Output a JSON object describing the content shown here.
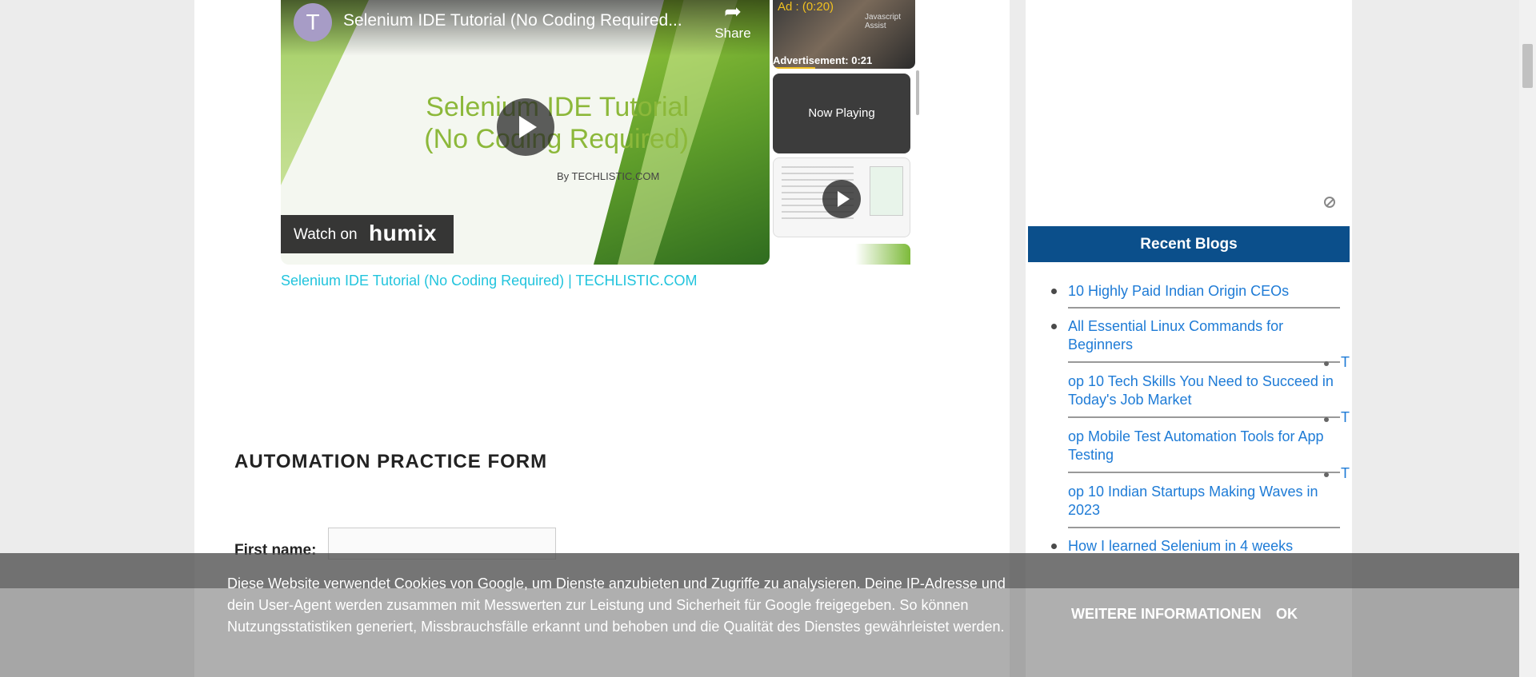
{
  "video": {
    "avatar_letter": "T",
    "title": "Selenium IDE Tutorial (No Coding Required...",
    "share_label": "Share",
    "share_icon": "share-arrow-icon",
    "slide_title_line1": "Selenium IDE Tutorial",
    "slide_title_line2": "(No Coding Required)",
    "slide_byline": "By TECHLISTIC.COM",
    "watch_on_label": "Watch on",
    "watch_on_brand": "humix"
  },
  "playlist": {
    "ad_label": "Ad : (0:20)",
    "ad_tag": "Javascript Assist",
    "ad_time": "Advertisement: 0:21",
    "ad_progress_fraction": 0.3,
    "now_playing": "Now Playing"
  },
  "video_link": "Selenium IDE Tutorial (No Coding Required) | TECHLISTIC.COM",
  "form": {
    "title": "AUTOMATION PRACTICE FORM",
    "first_name_label": "First name:",
    "first_name_value": ""
  },
  "sidebar": {
    "header": "Recent Blogs",
    "header_color": "#0b4f8b",
    "link_color": "#1e7bd6",
    "blogs": [
      {
        "label": "10 Highly Paid Indian Origin CEOs"
      },
      {
        "label": "All Essential Linux Commands for Beginners"
      },
      {
        "label": "op 10 Tech Skills You Need to Succeed in Today's Job Market",
        "lead": "T"
      },
      {
        "label": "op Mobile Test Automation Tools for App Testing",
        "lead": "T"
      },
      {
        "label": "op 10 Indian Startups Making Waves in 2023",
        "lead": "T"
      },
      {
        "label": "How I learned Selenium in 4 weeks"
      }
    ]
  },
  "cookie": {
    "text": "Diese Website verwendet Cookies von Google, um Dienste anzubieten und Zugriffe zu analysieren. Deine IP-Adresse und dein User-Agent werden zusammen mit Messwerten zur Leistung und Sicherheit für Google freigegeben. So können Nutzungsstatistiken generiert, Missbrauchsfälle erkannt und behoben und die Qualität des Dienstes gewährleistet werden.",
    "more_button": "WEITERE INFORMATIONEN",
    "ok_button": "OK"
  }
}
